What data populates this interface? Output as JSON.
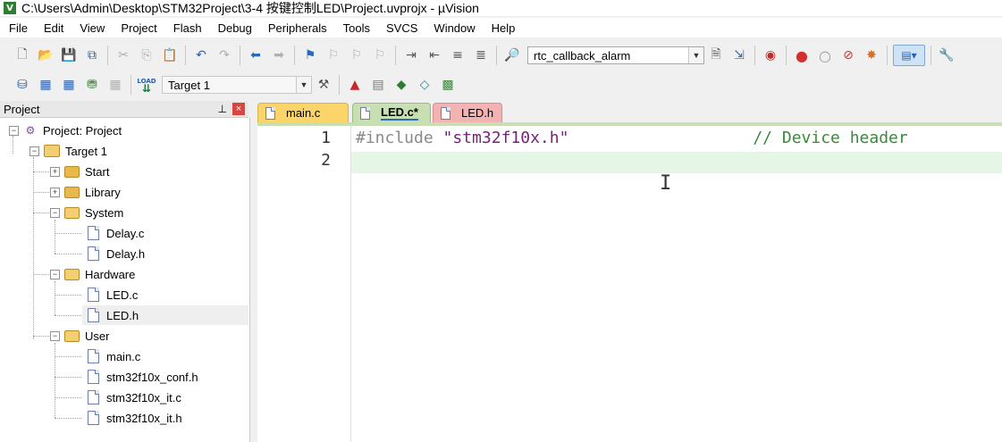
{
  "window": {
    "title": "C:\\Users\\Admin\\Desktop\\STM32Project\\3-4 按键控制LED\\Project.uvprojx - µVision",
    "app_icon_letter": "V"
  },
  "menu": [
    "File",
    "Edit",
    "View",
    "Project",
    "Flash",
    "Debug",
    "Peripherals",
    "Tools",
    "SVCS",
    "Window",
    "Help"
  ],
  "toolbar1": {
    "find_combo_value": "rtc_callback_alarm"
  },
  "toolbar2": {
    "target_combo_value": "Target 1",
    "load_label": "LOAD"
  },
  "project_panel": {
    "title": "Project",
    "pin_glyph": "⊥",
    "close_glyph": "×",
    "tree": {
      "root": "Project: Project",
      "target": "Target 1",
      "groups": {
        "start": "Start",
        "library": "Library",
        "system": "System",
        "hardware": "Hardware",
        "user": "User"
      },
      "files": {
        "delay_c": "Delay.c",
        "delay_h": "Delay.h",
        "led_c": "LED.c",
        "led_h": "LED.h",
        "main_c": "main.c",
        "conf_h": "stm32f10x_conf.h",
        "it_c": "stm32f10x_it.c",
        "it_h": "stm32f10x_it.h"
      }
    }
  },
  "editor": {
    "tabs": [
      {
        "label": "main.c",
        "color": "#fbd56a"
      },
      {
        "label": "LED.c*",
        "color": "#c7dfb2",
        "active": true
      },
      {
        "label": "LED.h",
        "color": "#f3b3b3"
      }
    ],
    "lines": [
      {
        "num": "1",
        "directive": "#include",
        "path": "\"stm32f10x.h\"",
        "comment": "// Device header"
      },
      {
        "num": "2"
      }
    ],
    "current_line_color": "#e6f6e6"
  }
}
